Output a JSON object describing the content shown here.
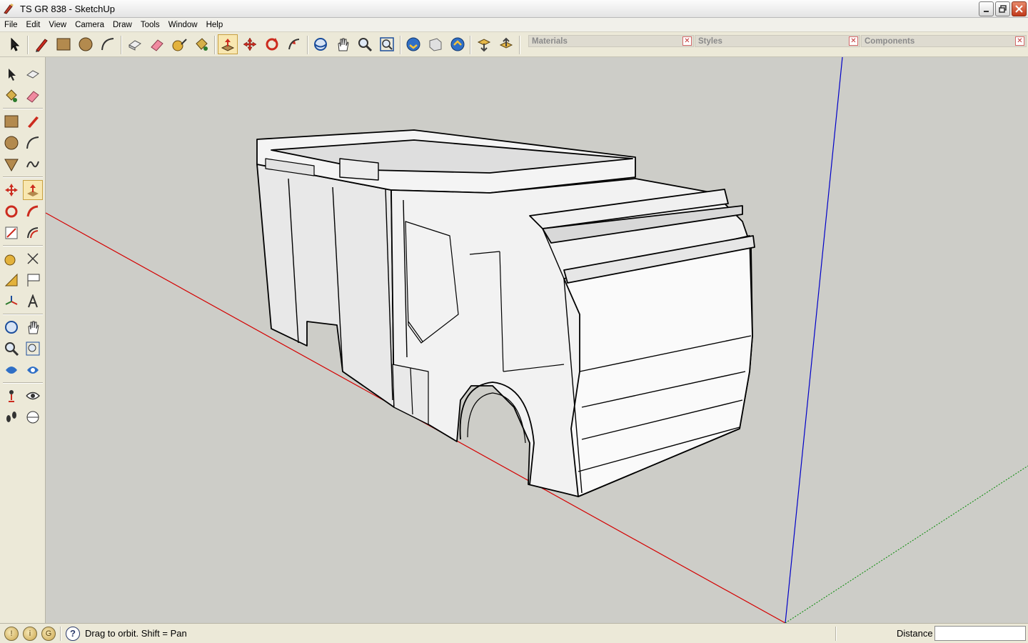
{
  "window": {
    "title": "TS GR 838 - SketchUp"
  },
  "menu": {
    "items": [
      "File",
      "Edit",
      "View",
      "Camera",
      "Draw",
      "Tools",
      "Window",
      "Help"
    ]
  },
  "toolbar": {
    "tools": [
      "select-icon",
      "pencil-icon",
      "rectangle-icon",
      "circle-icon",
      "arc-icon",
      "make-component-icon",
      "eraser-icon",
      "tape-measure-icon",
      "paint-bucket-icon",
      "push-pull-icon",
      "move-icon",
      "rotate-icon",
      "follow-me-icon",
      "orbit-icon",
      "pan-icon",
      "zoom-icon",
      "zoom-extents-icon",
      "get-models-icon",
      "share-model-icon",
      "upload-icon",
      "get-components-icon",
      "share-component-icon"
    ]
  },
  "trays": {
    "materials": "Materials",
    "styles": "Styles",
    "components": "Components"
  },
  "status": {
    "message": "Drag to orbit.  Shift = Pan",
    "measurement_label": "Distance",
    "measurement_value": ""
  },
  "colors": {
    "accent_red": "#cc0000",
    "viewport_bg": "#cdcdc8",
    "axis_red": "#d40000",
    "axis_blue": "#0000c8",
    "axis_green": "#008800"
  }
}
